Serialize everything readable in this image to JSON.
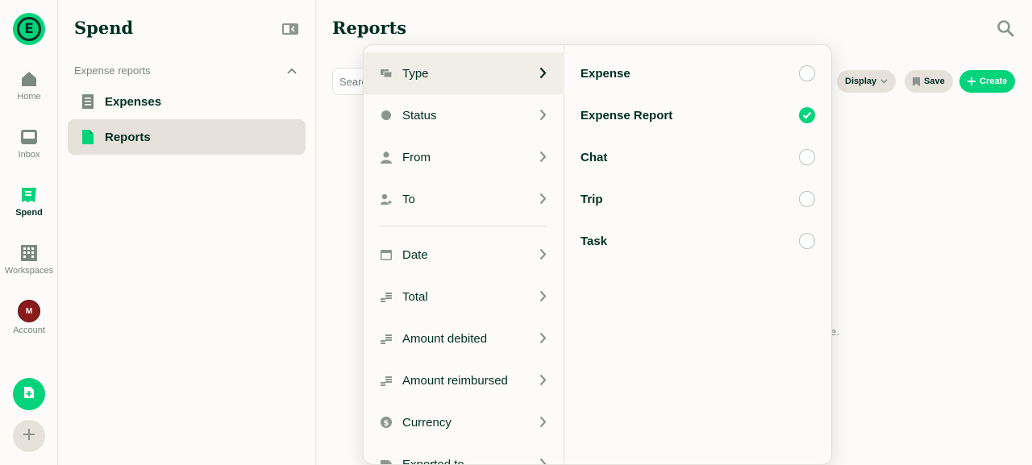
{
  "rail": {
    "logo_letter": "E",
    "items": [
      {
        "label": "Home",
        "icon": "home-icon"
      },
      {
        "label": "Inbox",
        "icon": "inbox-icon"
      },
      {
        "label": "Spend",
        "icon": "receipt-icon"
      },
      {
        "label": "Workspaces",
        "icon": "building-icon"
      },
      {
        "label": "Account",
        "icon": "avatar"
      }
    ],
    "avatar_initial": "M",
    "fab_create_icon": "new-expense-icon",
    "fab_add_icon": "plus-icon"
  },
  "sidebar": {
    "title": "Spend",
    "section_label": "Expense reports",
    "items": [
      {
        "label": "Expenses",
        "icon": "receipt-icon"
      },
      {
        "label": "Reports",
        "icon": "document-icon"
      }
    ]
  },
  "main": {
    "title": "Reports",
    "search_placeholder": "Search",
    "buttons": {
      "display": "Display",
      "save": "Save",
      "create": "Create"
    },
    "empty_text_tail": "e."
  },
  "filters": {
    "categories": [
      {
        "label": "Type",
        "icon": "type-icon",
        "active": true
      },
      {
        "label": "Status",
        "icon": "status-dot-icon"
      },
      {
        "label": "From",
        "icon": "person-icon"
      },
      {
        "label": "To",
        "icon": "person-arrow-icon"
      },
      {
        "label": "Date",
        "icon": "calendar-icon"
      },
      {
        "label": "Total",
        "icon": "coins-icon"
      },
      {
        "label": "Amount debited",
        "icon": "coins-icon"
      },
      {
        "label": "Amount reimbursed",
        "icon": "coins-icon"
      },
      {
        "label": "Currency",
        "icon": "dollar-icon"
      },
      {
        "label": "Exported to",
        "icon": "export-icon"
      }
    ],
    "type_options": [
      {
        "label": "Expense",
        "selected": false
      },
      {
        "label": "Expense Report",
        "selected": true
      },
      {
        "label": "Chat",
        "selected": false
      },
      {
        "label": "Trip",
        "selected": false
      },
      {
        "label": "Task",
        "selected": false
      }
    ]
  },
  "colors": {
    "brand_green": "#03d47c",
    "ink": "#002e22",
    "muted": "#76847e"
  }
}
